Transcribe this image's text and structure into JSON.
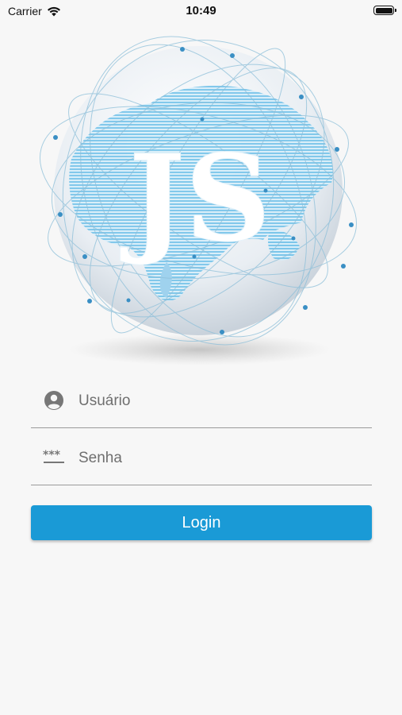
{
  "status_bar": {
    "carrier": "Carrier",
    "time": "10:49"
  },
  "logo": {
    "text": "JS",
    "icon": "globe-network-icon"
  },
  "form": {
    "username_placeholder": "Usuário",
    "username_value": "",
    "username_icon": "account-circle-icon",
    "password_placeholder": "Senha",
    "password_value": "",
    "password_icon": "password-dots-icon",
    "login_label": "Login"
  },
  "colors": {
    "accent": "#1a9ad6",
    "background": "#f7f7f7"
  }
}
